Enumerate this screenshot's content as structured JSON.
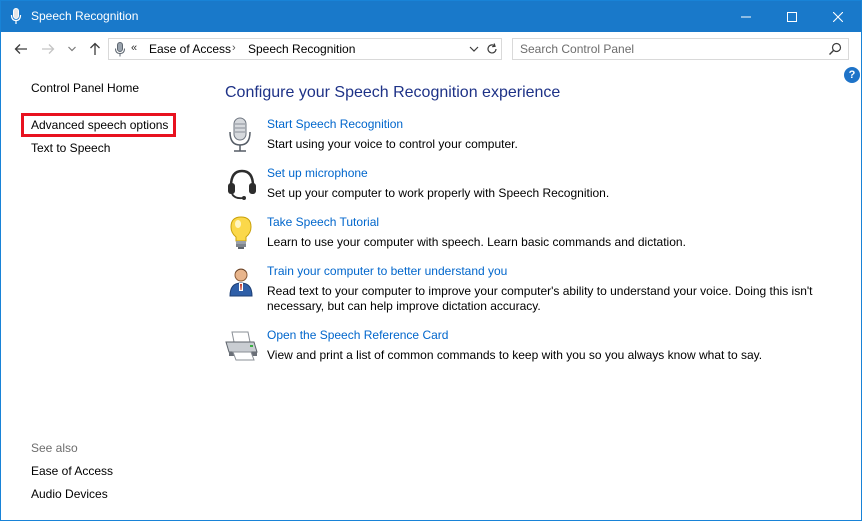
{
  "window": {
    "title": "Speech Recognition",
    "accent_color": "#1979ca",
    "controls": {
      "minimize": "minimize-icon",
      "maximize": "maximize-icon",
      "close": "close-icon"
    }
  },
  "nav": {
    "back": "back-arrow-icon",
    "forward": "forward-arrow-icon",
    "recent": "chevron-down-icon",
    "up": "up-arrow-icon"
  },
  "address": {
    "overflow": "«",
    "crumbs": [
      "Ease of Access",
      "Speech Recognition"
    ],
    "separator": "›"
  },
  "search": {
    "placeholder": "Search Control Panel"
  },
  "help": {
    "label": "?"
  },
  "leftpane": {
    "home": "Control Panel Home",
    "advanced": "Advanced speech options",
    "tts": "Text to Speech",
    "see_also": "See also",
    "ease": "Ease of Access",
    "audio": "Audio Devices"
  },
  "main": {
    "title": "Configure your Speech Recognition experience",
    "tasks": [
      {
        "icon": "microphone-icon",
        "link": "Start Speech Recognition",
        "desc": "Start using your voice to control your computer."
      },
      {
        "icon": "headset-icon",
        "link": "Set up microphone",
        "desc": "Set up your computer to work properly with Speech Recognition."
      },
      {
        "icon": "lightbulb-icon",
        "link": "Take Speech Tutorial",
        "desc": "Learn to use your computer with speech.  Learn basic commands and dictation."
      },
      {
        "icon": "user-train-icon",
        "link": "Train your computer to better understand you",
        "desc": "Read text to your computer to improve your computer's ability to understand your voice.  Doing this isn't necessary, but can help improve dictation accuracy."
      },
      {
        "icon": "printer-icon",
        "link": "Open the Speech Reference Card",
        "desc": "View and print a list of common commands to keep with you so you always know what to say."
      }
    ]
  }
}
